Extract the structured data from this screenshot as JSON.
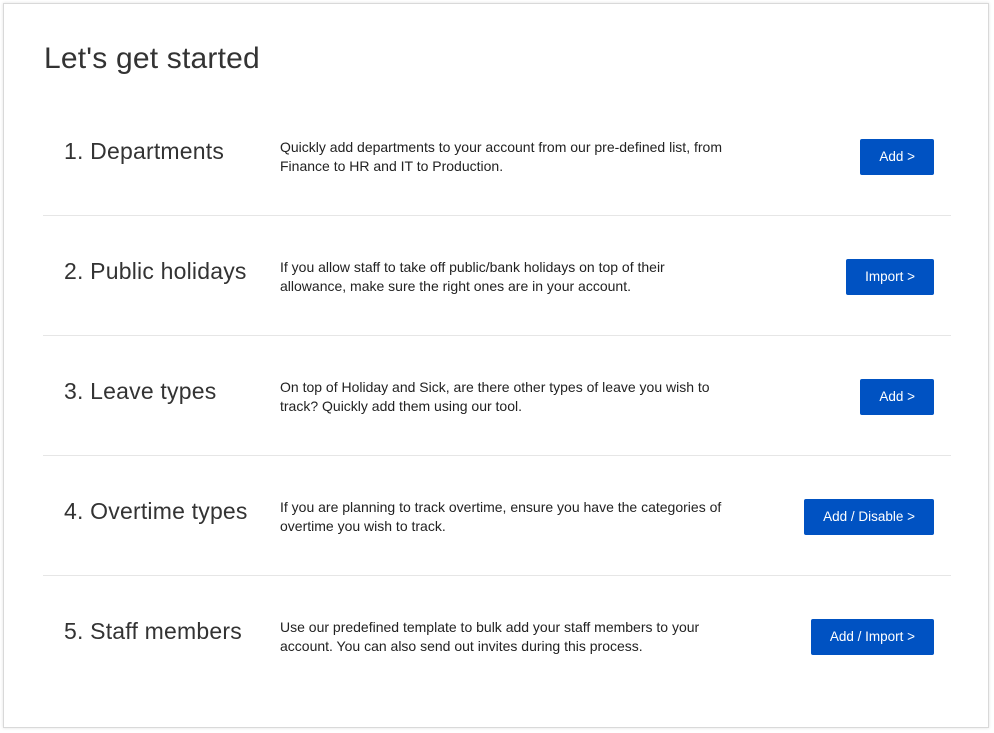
{
  "page": {
    "title": "Let's get started"
  },
  "steps": [
    {
      "title": "1. Departments",
      "description": "Quickly add departments to your account from our pre-defined list, from Finance to HR and IT to Production.",
      "button_label": "Add >"
    },
    {
      "title": "2. Public holidays",
      "description": "If you allow staff to take off public/bank holidays on top of their allowance, make sure the right ones are in your account.",
      "button_label": "Import >"
    },
    {
      "title": "3. Leave types",
      "description": "On top of Holiday and Sick, are there other types of leave you wish to track? Quickly add them using our tool.",
      "button_label": "Add >"
    },
    {
      "title": "4. Overtime types",
      "description": "If you are planning to track overtime, ensure you have the categories of overtime you wish to track.",
      "button_label": "Add / Disable >"
    },
    {
      "title": "5. Staff members",
      "description": "Use our predefined template to bulk add your staff members to your account. You can also send out invites during this process.",
      "button_label": "Add / Import >"
    }
  ],
  "colors": {
    "button_bg": "#0052c2",
    "button_text": "#ffffff",
    "divider": "#e6e6e6",
    "text": "#333333"
  }
}
